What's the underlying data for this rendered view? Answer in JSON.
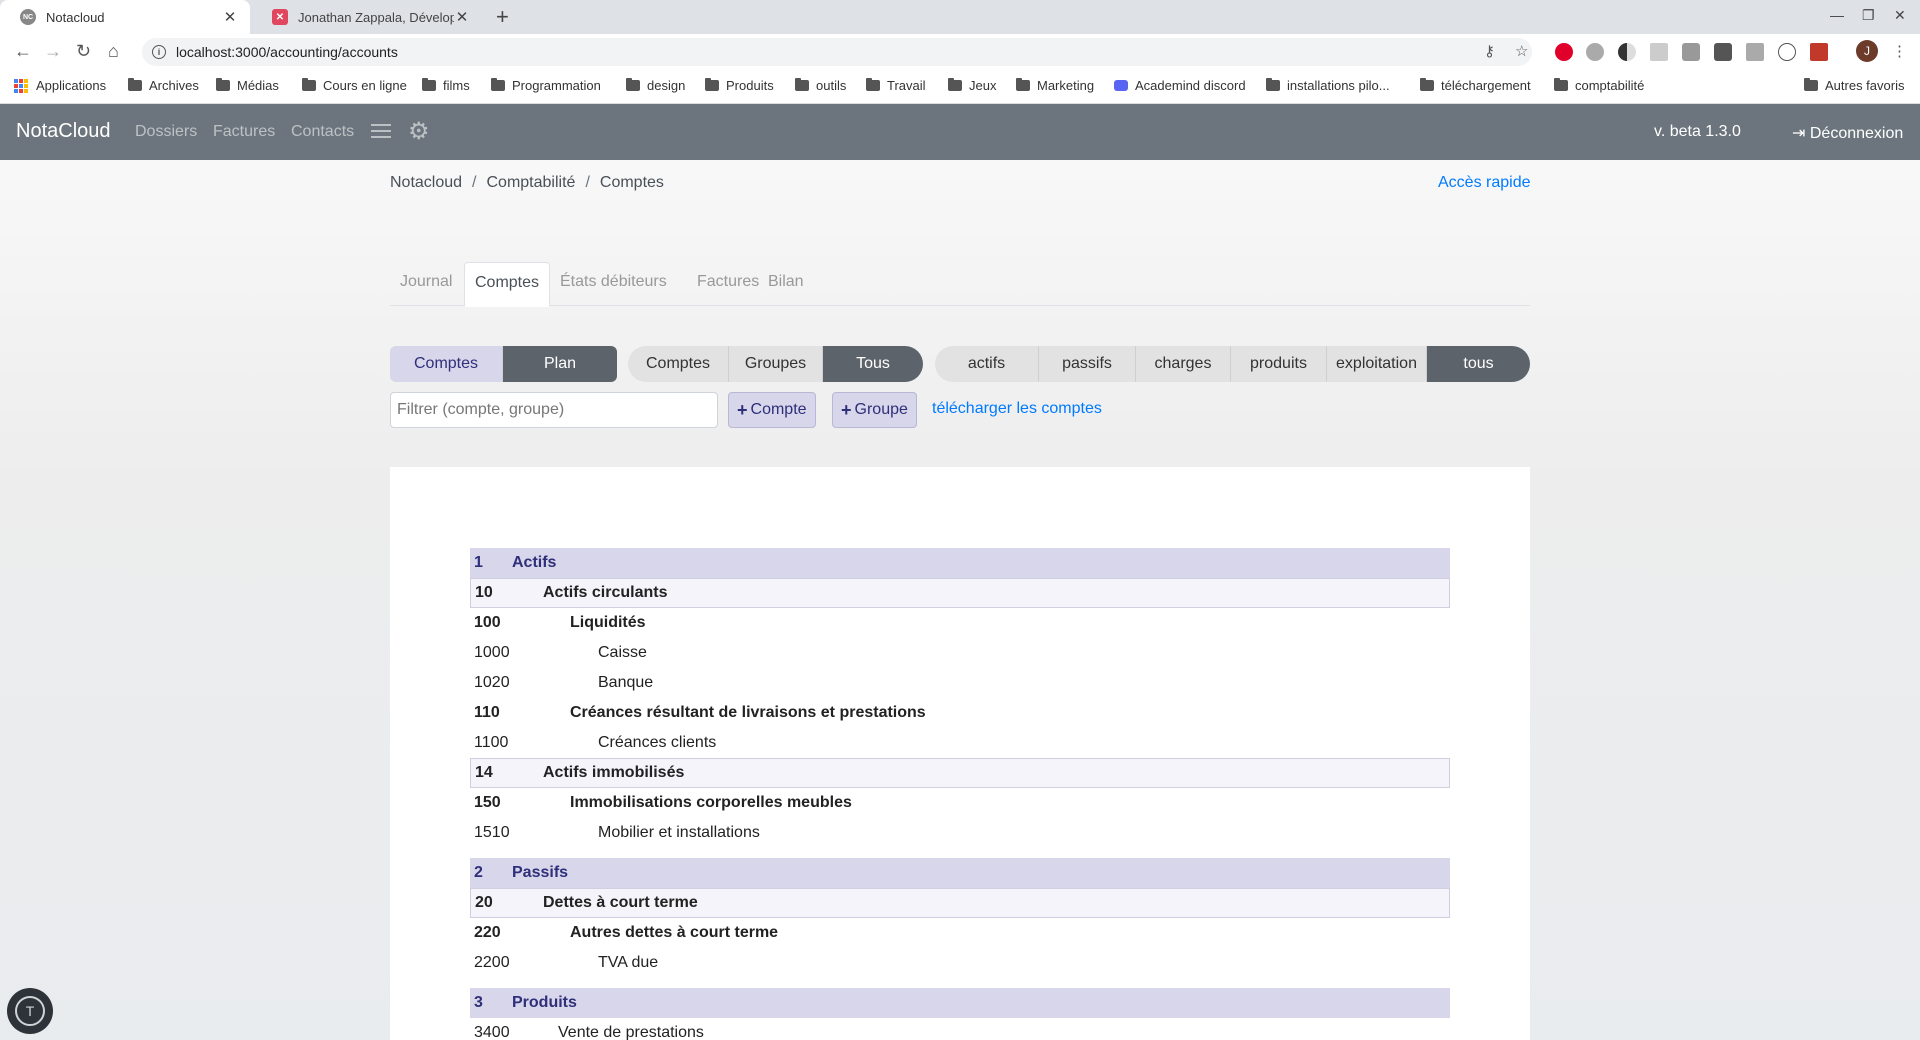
{
  "browser": {
    "tabs": [
      {
        "title": "Notacloud",
        "favicon": "NC"
      },
      {
        "title": "Jonathan Zappala, Développe",
        "favicon": "✕"
      }
    ],
    "url": "localhost:3000/accounting/accounts",
    "bookmarks": [
      "Applications",
      "Archives",
      "Médias",
      "Cours en ligne",
      "films",
      "Programmation",
      "design",
      "Produits",
      "outils",
      "Travail",
      "Jeux",
      "Marketing",
      "Academind discord",
      "installations pilo...",
      "téléchargement",
      "comptabilité"
    ],
    "other_bookmarks": "Autres favoris",
    "profile_initial": "J"
  },
  "navbar": {
    "brand": "NotaCloud",
    "links": [
      "Dossiers",
      "Factures",
      "Contacts"
    ],
    "version": "v. beta 1.3.0",
    "logout": "Déconnexion"
  },
  "breadcrumb": [
    "Notacloud",
    "Comptabilité",
    "Comptes"
  ],
  "quick_access": "Accès rapide",
  "page_tabs": [
    "Journal",
    "Comptes",
    "États débiteurs",
    "Factures",
    "Bilan"
  ],
  "view_toggle": [
    "Comptes",
    "Plan"
  ],
  "type_toggle": [
    "Comptes",
    "Groupes",
    "Tous"
  ],
  "category_toggle": [
    "actifs",
    "passifs",
    "charges",
    "produits",
    "exploitation",
    "tous"
  ],
  "filter_placeholder": "Filtrer (compte, groupe)",
  "add_account": "Compte",
  "add_group": "Groupe",
  "download_link": "télécharger les comptes",
  "plan": [
    {
      "num": "1",
      "label": "Actifs"
    },
    {
      "num": "10",
      "label": "Actifs circulants"
    },
    {
      "num": "100",
      "label": "Liquidités"
    },
    {
      "num": "1000",
      "label": "Caisse"
    },
    {
      "num": "1020",
      "label": "Banque"
    },
    {
      "num": "110",
      "label": "Créances résultant de livraisons et prestations"
    },
    {
      "num": "1100",
      "label": "Créances clients"
    },
    {
      "num": "14",
      "label": "Actifs immobilisés"
    },
    {
      "num": "150",
      "label": "Immobilisations corporelles meubles"
    },
    {
      "num": "1510",
      "label": "Mobilier et installations"
    },
    {
      "num": "2",
      "label": "Passifs"
    },
    {
      "num": "20",
      "label": "Dettes à court terme"
    },
    {
      "num": "220",
      "label": "Autres dettes à court terme"
    },
    {
      "num": "2200",
      "label": "TVA due"
    },
    {
      "num": "3",
      "label": "Produits"
    },
    {
      "num": "3400",
      "label": "Vente de prestations"
    }
  ],
  "colors": {
    "navbar": "#6c757d",
    "accent": "#d7d6ea",
    "link": "#007bff"
  }
}
